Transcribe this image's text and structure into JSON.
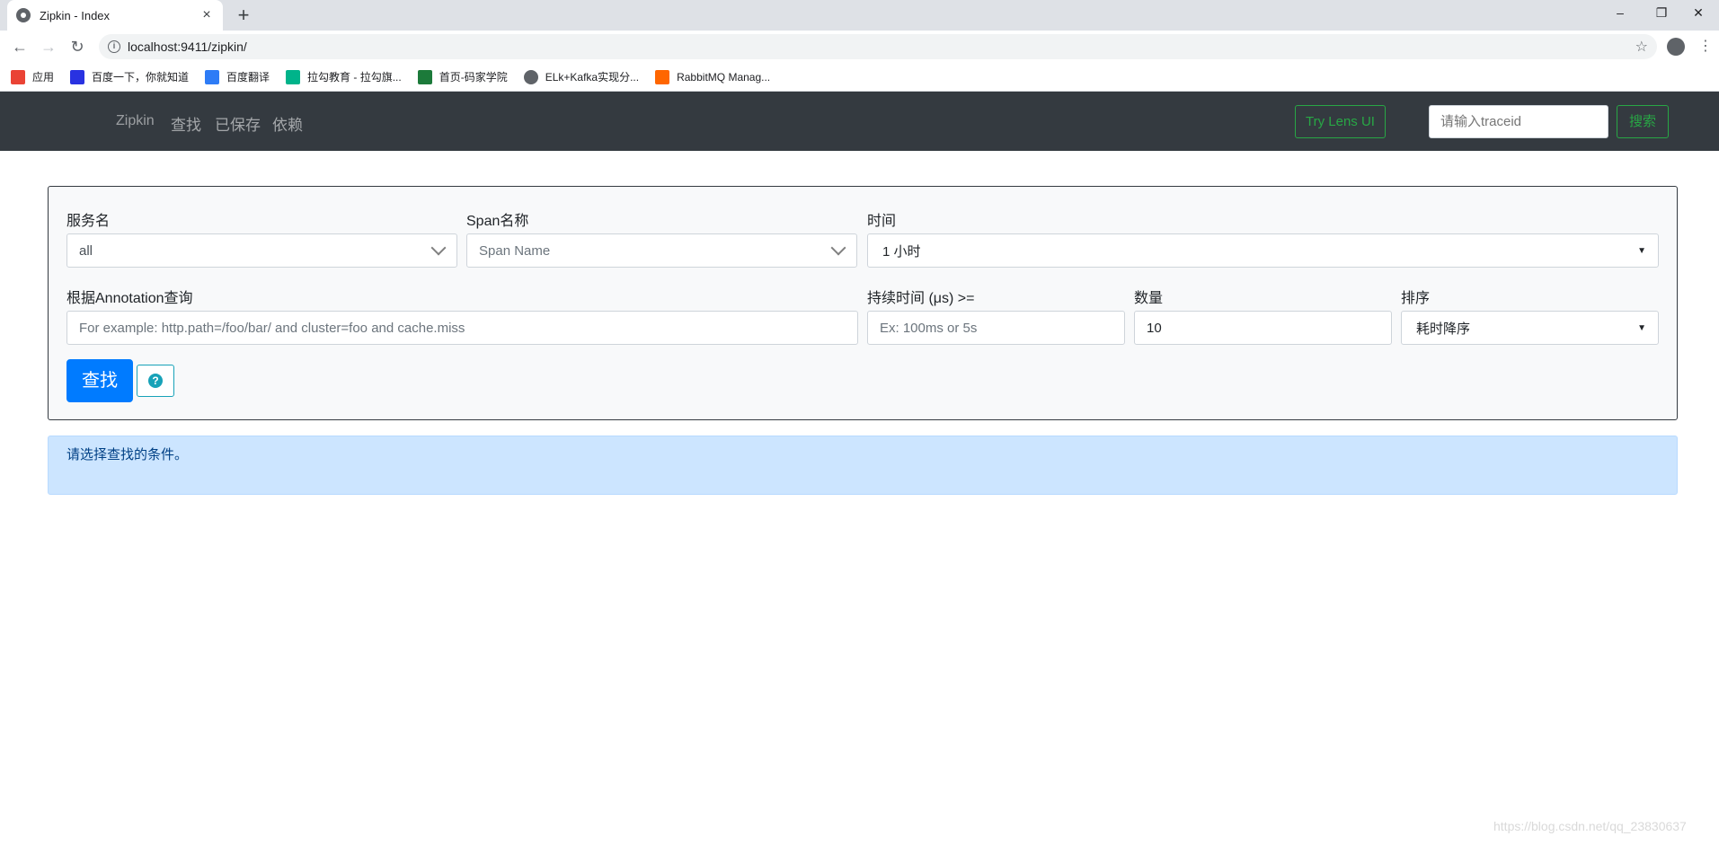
{
  "browser": {
    "tab_title": "Zipkin - Index",
    "tab_close": "×",
    "new_tab": "+",
    "url": "localhost:9411/zipkin/",
    "window_controls": {
      "minimize": "–",
      "restore": "❐",
      "close": "✕"
    },
    "nav": {
      "back": "←",
      "forward": "→",
      "reload": "↻"
    },
    "star": "☆",
    "menu": "⋮",
    "bookmarks": [
      {
        "label": "应用",
        "icon": "apps-grid-icon",
        "color": "#ea4335"
      },
      {
        "label": "百度一下，你就知道",
        "icon": "baidu-paw-icon",
        "color": "#2932e1"
      },
      {
        "label": "百度翻译",
        "icon": "translate-icon",
        "color": "#2e7cf6"
      },
      {
        "label": "拉勾教育 - 拉勾旗...",
        "icon": "lagou-icon",
        "color": "#00b38a"
      },
      {
        "label": "首页-码家学院",
        "icon": "m-logo-icon",
        "color": "#1c7a3a"
      },
      {
        "label": "ELk+Kafka实现分...",
        "icon": "globe-icon",
        "color": "#5f6368"
      },
      {
        "label": "RabbitMQ Manag...",
        "icon": "rabbitmq-icon",
        "color": "#ff6600"
      }
    ]
  },
  "navbar": {
    "brand": "Zipkin",
    "links": [
      "查找",
      "已保存",
      "依赖"
    ],
    "lens_button": "Try Lens UI",
    "traceid_placeholder": "请输入traceid",
    "search_button": "搜索"
  },
  "form": {
    "service_label": "服务名",
    "service_value": "all",
    "span_label": "Span名称",
    "span_placeholder": "Span Name",
    "time_label": "时间",
    "time_value": "1 小时",
    "annotation_label": "根据Annotation查询",
    "annotation_placeholder": "For example: http.path=/foo/bar/ and cluster=foo and cache.miss",
    "duration_label": "持续时间 (μs) >=",
    "duration_placeholder": "Ex: 100ms or 5s",
    "limit_label": "数量",
    "limit_value": "10",
    "sort_label": "排序",
    "sort_value": "耗时降序",
    "find_button": "查找",
    "help_icon": "?"
  },
  "alert": {
    "message": "请选择查找的条件。"
  },
  "watermark": "https://blog.csdn.net/qq_23830637",
  "colors": {
    "navbar_bg": "#343a40",
    "primary": "#007bff",
    "success": "#28a745",
    "info": "#17a2b8",
    "alert_bg": "#cce5ff"
  }
}
